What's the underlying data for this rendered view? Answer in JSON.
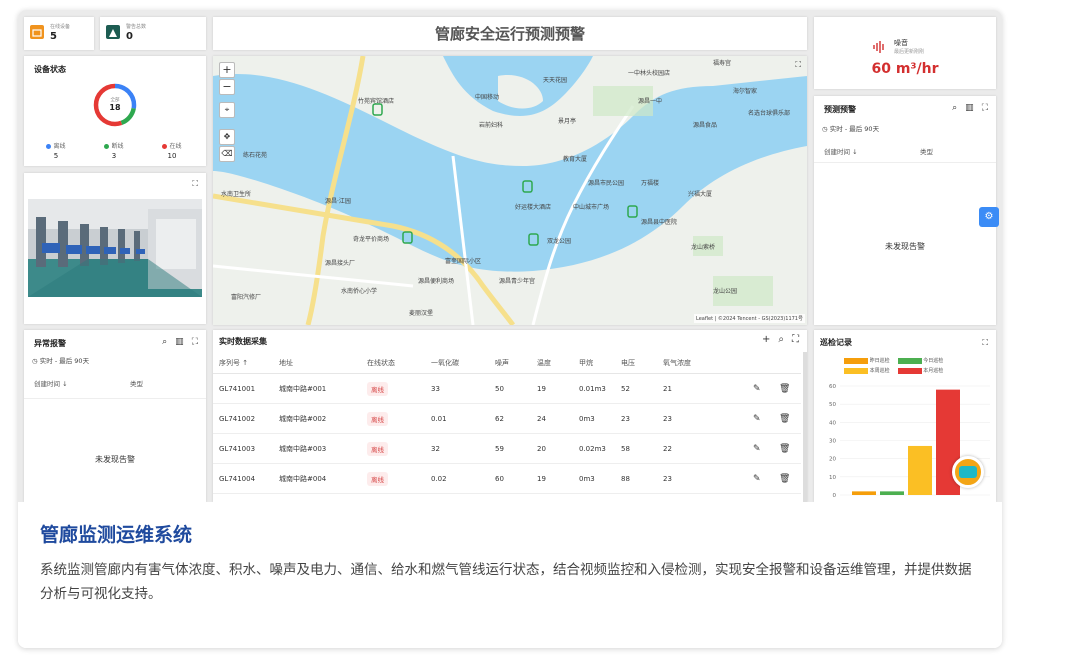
{
  "stats": [
    {
      "label": "在线设备",
      "value": "5",
      "color": "#f0931e"
    },
    {
      "label": "警告总数",
      "value": "0",
      "color": "#1d5c52"
    }
  ],
  "banner_title": "管廊安全运行预测预警",
  "noise": {
    "label": "噪音",
    "sublabel": "最后更新刚刚",
    "value": "60 m³/hr"
  },
  "device_status": {
    "title": "设备状态",
    "center_label": "全部",
    "center_value": "18",
    "legend": [
      {
        "label": "离线",
        "value": "5",
        "color": "#3b82f6"
      },
      {
        "label": "断线",
        "value": "3",
        "color": "#2ea84f"
      },
      {
        "label": "在线",
        "value": "10",
        "color": "#e53935"
      }
    ]
  },
  "forecast": {
    "title": "预测预警",
    "subtitle": "实时 - 最后 90天",
    "col1": "创建时间 ↓",
    "col2": "类型",
    "empty": "未发现告警"
  },
  "alarm": {
    "title": "异常报警",
    "subtitle": "实时 - 最后 90天",
    "col1": "创建时间 ↓",
    "col2": "类型",
    "empty": "未发现告警"
  },
  "realtime": {
    "title": "实时数据采集",
    "headers": [
      "序列号 ↑",
      "地址",
      "在线状态",
      "一氧化碳",
      "噪声",
      "温度",
      "甲烷",
      "电压",
      "氧气浓度"
    ],
    "rows": [
      [
        "GL741001",
        "城南中路#001",
        "离线",
        "33",
        "50",
        "19",
        "0.01m3",
        "52",
        "21"
      ],
      [
        "GL741002",
        "城南中路#002",
        "离线",
        "0.01",
        "62",
        "24",
        "0m3",
        "23",
        "23"
      ],
      [
        "GL741003",
        "城南中路#003",
        "离线",
        "32",
        "59",
        "20",
        "0.02m3",
        "58",
        "22"
      ],
      [
        "GL741004",
        "城南中路#004",
        "离线",
        "0.02",
        "60",
        "19",
        "0m3",
        "88",
        "23"
      ]
    ]
  },
  "patrol": {
    "title": "巡检记录",
    "legend": [
      "昨日巡检",
      "今日巡检",
      "本周巡检",
      "本月巡检"
    ],
    "colors": [
      "#f59e0b",
      "#4caf50",
      "#fbbf24",
      "#e53935"
    ]
  },
  "chart_data": {
    "type": "bar",
    "title": "巡检记录",
    "categories": [
      "昨日巡检",
      "今日巡检",
      "本周巡检",
      "本月巡检"
    ],
    "values": [
      2,
      2,
      27,
      58
    ],
    "ylim": [
      0,
      60
    ],
    "yticks": [
      "0",
      "10",
      "20",
      "30",
      "40",
      "50",
      "60"
    ],
    "legend_position": "top",
    "grid": true
  },
  "map": {
    "attribution": "Leaflet | ©2024 Tencent - GS(2023)1171号",
    "labels": [
      {
        "text": "天天花园"
      },
      {
        "text": "一中林头校园店"
      },
      {
        "text": "福寿宫"
      },
      {
        "text": "竹苑宾馆酒店"
      },
      {
        "text": "中国移动"
      },
      {
        "text": "源昌一中"
      },
      {
        "text": "海尔智家"
      },
      {
        "text": "名选台球俱乐部"
      },
      {
        "text": "岩前妇科"
      },
      {
        "text": "景月亭"
      },
      {
        "text": "源昌食品"
      },
      {
        "text": "练石花苑"
      },
      {
        "text": "教育大厦"
      },
      {
        "text": "源昌市民公园"
      },
      {
        "text": "万福楼"
      },
      {
        "text": "兴福大厦"
      },
      {
        "text": "水南卫生所"
      },
      {
        "text": "源昌·江园"
      },
      {
        "text": "好运楼大酒店"
      },
      {
        "text": "中山城市广场"
      },
      {
        "text": "源昌县中医院"
      },
      {
        "text": "奇龙平价商场"
      },
      {
        "text": "双龙公园"
      },
      {
        "text": "龙山索桥"
      },
      {
        "text": "源昌接头厂"
      },
      {
        "text": "富奎国际小区"
      },
      {
        "text": "源昌便利商场"
      },
      {
        "text": "源昌青少年宫"
      },
      {
        "text": "水南侨心小学"
      },
      {
        "text": "龙山公园"
      },
      {
        "text": "富阳汽修厂"
      },
      {
        "text": "麦丽汉堡"
      }
    ]
  },
  "caption": {
    "title": "管廊监测运维系统",
    "text": "系统监测管廊内有害气体浓度、积水、噪声及电力、通信、给水和燃气管线运行状态，结合视频监控和入侵检测，实现安全报警和设备运维管理，并提供数据分析与可视化支持。"
  }
}
